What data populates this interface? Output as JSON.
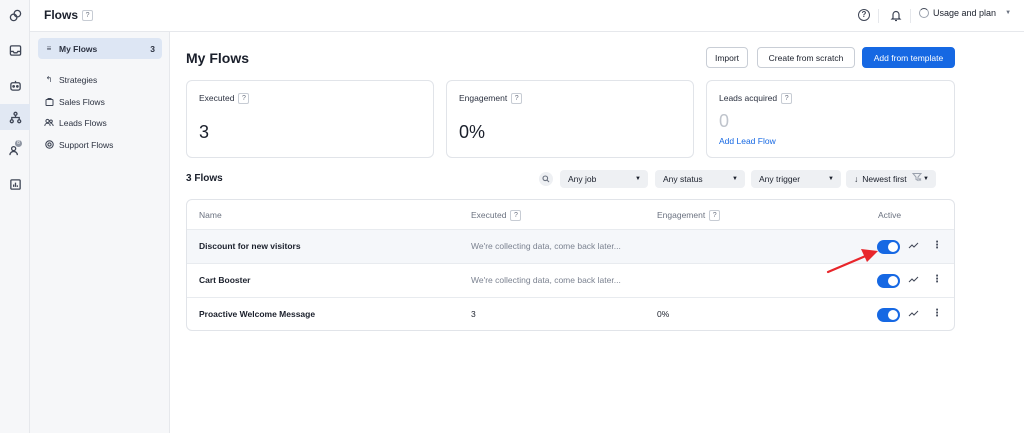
{
  "topbar": {
    "title": "Flows",
    "title_help": "?",
    "help_icon": "?",
    "usage_label": "Usage and plan"
  },
  "rail": {
    "icons": [
      "flows-logo-icon",
      "inbox-icon",
      "bot-icon",
      "flows-icon",
      "contacts-icon",
      "analytics-icon"
    ],
    "badge": "8"
  },
  "subnav": {
    "items": [
      {
        "label": "My Flows",
        "count": "3",
        "icon": "list-icon"
      },
      {
        "label": "Strategies",
        "icon": "strategy-icon"
      },
      {
        "label": "Sales Flows",
        "icon": "bag-icon"
      },
      {
        "label": "Leads Flows",
        "icon": "people-icon"
      },
      {
        "label": "Support Flows",
        "icon": "lifebuoy-icon"
      }
    ]
  },
  "main": {
    "title": "My Flows",
    "import_label": "Import",
    "create_label": "Create from scratch",
    "template_label": "Add from template"
  },
  "cards": [
    {
      "label": "Executed",
      "help": "?",
      "value": "3"
    },
    {
      "label": "Engagement",
      "help": "?",
      "value": "0%"
    },
    {
      "label": "Leads acquired",
      "help": "?",
      "value": "0",
      "link": "Add Lead Flow"
    }
  ],
  "list": {
    "count_label": "3 Flows",
    "filters": {
      "job": "Any job",
      "status": "Any status",
      "trigger": "Any trigger",
      "sort": "Newest first"
    }
  },
  "table": {
    "headers": {
      "name": "Name",
      "executed": "Executed",
      "executed_help": "?",
      "engagement": "Engagement",
      "engagement_help": "?",
      "active": "Active"
    },
    "rows": [
      {
        "name": "Discount for new visitors",
        "executed": "We're collecting data, come back later...",
        "engagement": "",
        "active": true
      },
      {
        "name": "Cart Booster",
        "executed": "We're collecting data, come back later...",
        "engagement": "",
        "active": true
      },
      {
        "name": "Proactive Welcome Message",
        "executed": "3",
        "engagement": "0%",
        "active": true
      }
    ]
  },
  "colors": {
    "accent": "#1668e3",
    "annotation_arrow": "#e8262b"
  }
}
